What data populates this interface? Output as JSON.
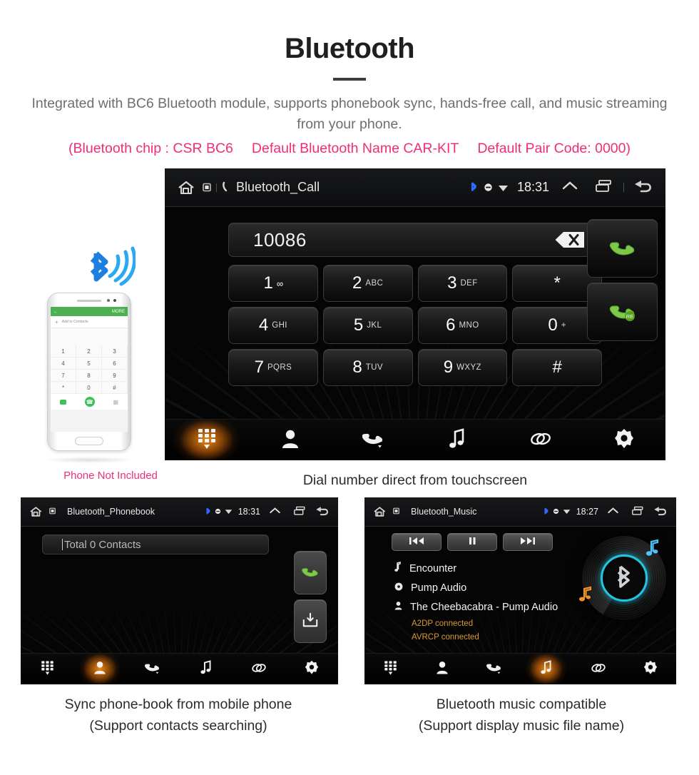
{
  "header": {
    "title": "Bluetooth",
    "description": "Integrated with BC6 Bluetooth module, supports phonebook sync, hands-free call, and music streaming from your phone.",
    "spec_chip": "(Bluetooth chip : CSR BC6",
    "spec_name": "Default Bluetooth Name CAR-KIT",
    "spec_pair": "Default Pair Code: 0000)",
    "accent_pink": "#ef2d7a",
    "text_gray": "#6e6e6e"
  },
  "phone_mockup": {
    "note": "Phone Not Included",
    "screen": {
      "more_label": "MORE",
      "add_contacts": "Add to Contacts",
      "keys": [
        "1",
        "2",
        "3",
        "4",
        "5",
        "6",
        "7",
        "8",
        "9",
        "*",
        "0",
        "#"
      ]
    }
  },
  "call_screen": {
    "statusbar": {
      "title": "Bluetooth_Call",
      "time": "18:31",
      "bluetooth_icon": "bluetooth-icon",
      "mute_icon": "mute-icon",
      "wifi_icon": "wifi-icon",
      "expand_icon": "chevron-up-icon",
      "recents_icon": "recents-icon",
      "back_icon": "back-icon",
      "home_icon": "home-icon",
      "sd_icon": "sdcard-icon",
      "phone_icon": "phone-icon",
      "bluetooth_color": "#2e6bff"
    },
    "number_value": "10086",
    "backspace_icon": "backspace-icon",
    "keys": [
      {
        "num": "1",
        "sub": "∞",
        "voicemail": true
      },
      {
        "num": "2",
        "sub": "ABC"
      },
      {
        "num": "3",
        "sub": "DEF"
      },
      {
        "num": "*",
        "sub": ""
      },
      {
        "num": "4",
        "sub": "GHI"
      },
      {
        "num": "5",
        "sub": "JKL"
      },
      {
        "num": "6",
        "sub": "MNO"
      },
      {
        "num": "0",
        "sub": "+"
      },
      {
        "num": "7",
        "sub": "PQRS"
      },
      {
        "num": "8",
        "sub": "TUV"
      },
      {
        "num": "9",
        "sub": "WXYZ"
      },
      {
        "num": "#",
        "sub": ""
      }
    ],
    "call_button_icon": "call-handset-icon",
    "redial_button_icon": "redial-handset-icon",
    "redial_badge": "RE",
    "nav": [
      {
        "name": "dialpad",
        "icon": "dialpad-icon",
        "active": true
      },
      {
        "name": "contacts",
        "icon": "contact-person-icon",
        "active": false
      },
      {
        "name": "call-log",
        "icon": "call-history-icon",
        "active": false
      },
      {
        "name": "music",
        "icon": "music-note-icon",
        "active": false
      },
      {
        "name": "pair",
        "icon": "link-chain-icon",
        "active": false
      },
      {
        "name": "settings",
        "icon": "gear-icon",
        "active": false
      }
    ],
    "caption": "Dial number direct from touchscreen",
    "accent_orange": "#ff9614"
  },
  "phonebook_screen": {
    "statusbar": {
      "title": "Bluetooth_Phonebook",
      "time": "18:31"
    },
    "search_value": "Total 0 Contacts",
    "buttons": [
      {
        "name": "call",
        "icon": "call-handset-icon"
      },
      {
        "name": "download-contacts",
        "icon": "download-tray-icon"
      }
    ],
    "nav": [
      {
        "name": "dialpad",
        "icon": "dialpad-icon",
        "active": false
      },
      {
        "name": "contacts",
        "icon": "contact-person-icon",
        "active": true
      },
      {
        "name": "call-log",
        "icon": "call-history-icon",
        "active": false
      },
      {
        "name": "music",
        "icon": "music-note-icon",
        "active": false
      },
      {
        "name": "pair",
        "icon": "link-chain-icon",
        "active": false
      },
      {
        "name": "settings",
        "icon": "gear-icon",
        "active": false
      }
    ],
    "caption_line1": "Sync phone-book from mobile phone",
    "caption_line2": "(Support contacts searching)"
  },
  "music_screen": {
    "statusbar": {
      "title": "Bluetooth_Music",
      "time": "18:27"
    },
    "transport": [
      {
        "name": "previous",
        "icon": "skip-back-icon"
      },
      {
        "name": "pause",
        "icon": "pause-icon"
      },
      {
        "name": "next",
        "icon": "skip-forward-icon"
      }
    ],
    "track": {
      "title": "Encounter",
      "album": "Pump Audio",
      "artist": "The Cheebacabra - Pump Audio",
      "title_icon": "music-note-small-icon",
      "album_icon": "disc-icon",
      "artist_icon": "person-small-icon"
    },
    "status_lines": [
      "A2DP connected",
      "AVRCP connected"
    ],
    "status_color": "#d99a32",
    "ring_color": "#20c5e0",
    "nav": [
      {
        "name": "dialpad",
        "icon": "dialpad-icon",
        "active": false
      },
      {
        "name": "contacts",
        "icon": "contact-person-icon",
        "active": false
      },
      {
        "name": "call-log",
        "icon": "call-history-icon",
        "active": false
      },
      {
        "name": "music",
        "icon": "music-note-icon",
        "active": true
      },
      {
        "name": "pair",
        "icon": "link-chain-icon",
        "active": false
      },
      {
        "name": "settings",
        "icon": "gear-icon",
        "active": false
      }
    ],
    "caption_line1": "Bluetooth music compatible",
    "caption_line2": "(Support display music file name)"
  }
}
